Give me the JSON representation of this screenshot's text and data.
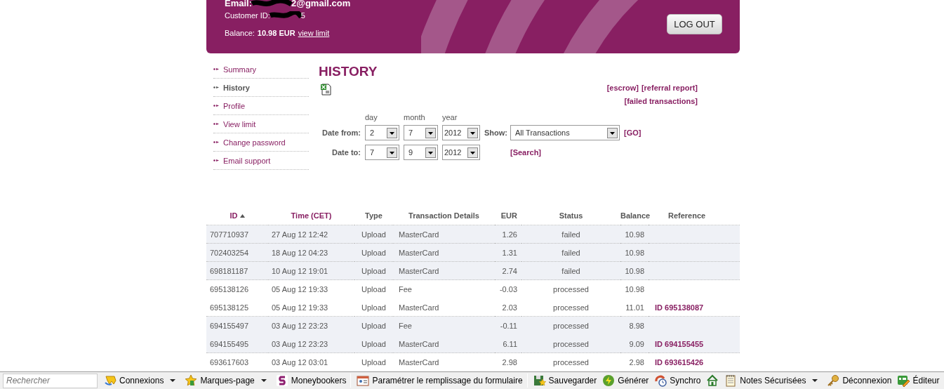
{
  "account": {
    "email_label": "Email:",
    "email_value": "2@gmail.com",
    "customer_label": "Customer ID:",
    "customer_value": "5",
    "balance_label": "Balance:",
    "balance_value": "10.98 EUR",
    "view_limit": "view limit"
  },
  "logout": "LOG OUT",
  "sidebar": {
    "items": [
      {
        "label": "Summary",
        "selected": false
      },
      {
        "label": "History",
        "selected": true
      },
      {
        "label": "Profile",
        "selected": false
      },
      {
        "label": "View limit",
        "selected": false
      },
      {
        "label": "Change password",
        "selected": false
      },
      {
        "label": "Email support",
        "selected": false
      }
    ]
  },
  "title": "HISTORY",
  "links": [
    [
      "[escrow]",
      "[referral report]"
    ],
    [
      "[failed transactions]"
    ]
  ],
  "filter": {
    "headings": [
      "day",
      "month",
      "year"
    ],
    "from_label": "Date from:",
    "from": [
      "2",
      "7",
      "2012"
    ],
    "to_label": "Date to:",
    "to": [
      "7",
      "9",
      "2012"
    ],
    "show_label": "Show:",
    "show_value": "All Transactions",
    "go": "[GO]",
    "search": "[Search]"
  },
  "table": {
    "columns": [
      {
        "label": "ID",
        "sortable": true,
        "sorted_ascending": true
      },
      {
        "label": "Time (CET)",
        "sortable": true,
        "sorted_ascending": false
      },
      {
        "label": "Type",
        "sortable": false,
        "sorted_ascending": false
      },
      {
        "label": "Transaction Details",
        "sortable": false,
        "sorted_ascending": false
      },
      {
        "label": "EUR",
        "sortable": false,
        "sorted_ascending": false
      },
      {
        "label": "Status",
        "sortable": false,
        "sorted_ascending": false
      },
      {
        "label": "Balance",
        "sortable": false,
        "sorted_ascending": false
      },
      {
        "label": "Reference",
        "sortable": false,
        "sorted_ascending": false
      }
    ],
    "rows": [
      {
        "shaded": true,
        "divider_above": true,
        "cells": [
          "707710937",
          "27 Aug 12 12:42",
          "Upload",
          "MasterCard",
          "1.26",
          "failed",
          "10.98",
          ""
        ]
      },
      {
        "shaded": true,
        "divider_above": true,
        "cells": [
          "702403254",
          "18 Aug 12 04:23",
          "Upload",
          "MasterCard",
          "1.31",
          "failed",
          "10.98",
          ""
        ]
      },
      {
        "shaded": true,
        "divider_above": true,
        "cells": [
          "698181187",
          "10 Aug 12 19:01",
          "Upload",
          "MasterCard",
          "2.74",
          "failed",
          "10.98",
          ""
        ]
      },
      {
        "shaded": false,
        "divider_above": true,
        "cells": [
          "695138126",
          "05 Aug 12 19:33",
          "Upload",
          "Fee",
          "-0.03",
          "processed",
          "10.98",
          ""
        ]
      },
      {
        "shaded": false,
        "divider_above": false,
        "cells": [
          "695138125",
          "05 Aug 12 19:33",
          "Upload",
          "MasterCard",
          "2.03",
          "processed",
          "11.01",
          "ID 695138087"
        ]
      },
      {
        "shaded": true,
        "divider_above": true,
        "cells": [
          "694155497",
          "03 Aug 12 23:23",
          "Upload",
          "Fee",
          "-0.11",
          "processed",
          "8.98",
          ""
        ]
      },
      {
        "shaded": true,
        "divider_above": false,
        "cells": [
          "694155495",
          "03 Aug 12 23:23",
          "Upload",
          "MasterCard",
          "6.11",
          "processed",
          "9.09",
          "ID 694155455"
        ]
      },
      {
        "shaded": false,
        "divider_above": true,
        "cells": [
          "693617603",
          "03 Aug 12 03:01",
          "Upload",
          "MasterCard",
          "2.98",
          "processed",
          "2.98",
          "ID 693615426"
        ]
      }
    ]
  },
  "toolbar": {
    "search_placeholder": "Rechercher",
    "items": [
      {
        "label": "Connexions",
        "menu": true,
        "separator_after": false
      },
      {
        "label": "Marques-page",
        "menu": true,
        "separator_after": false
      },
      {
        "label": "Moneybookers",
        "menu": false,
        "separator_after": true
      },
      {
        "label": "Paramétrer le remplissage du formulaire",
        "menu": false,
        "separator_after": true
      },
      {
        "label": "Sauvegarder",
        "menu": false,
        "separator_after": false
      },
      {
        "label": "Générer",
        "menu": false,
        "separator_after": false
      },
      {
        "label": "Synchro",
        "menu": false,
        "separator_after": false
      },
      {
        "menu": false,
        "separator_after": false
      },
      {
        "label": "Notes Sécurisées",
        "menu": true,
        "separator_after": false
      },
      {
        "label": "Déconnexion",
        "menu": false,
        "separator_after": false
      },
      {
        "label": "Éditeur",
        "menu": false,
        "separator_after": false
      }
    ]
  }
}
